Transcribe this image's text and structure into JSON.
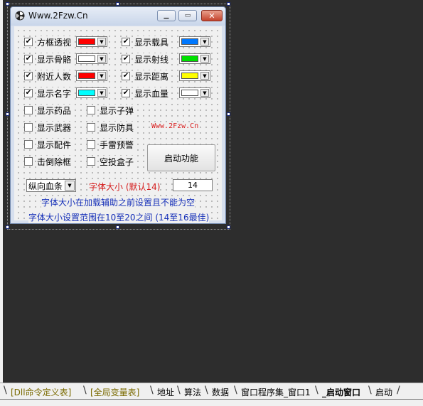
{
  "window": {
    "title": "Www.2Fzw.Cn"
  },
  "checkbox_grid": [
    {
      "label": "方框透视",
      "checked": true,
      "color": "#ff0000"
    },
    {
      "label": "显示骨骼",
      "checked": true,
      "color": "#ffffff"
    },
    {
      "label": "附近人数",
      "checked": true,
      "color": "#ff0000"
    },
    {
      "label": "显示名字",
      "checked": true,
      "color": "#00ffff"
    },
    {
      "label": "显示载具",
      "checked": true,
      "color": "#0078ff"
    },
    {
      "label": "显示射线",
      "checked": true,
      "color": "#00e000"
    },
    {
      "label": "显示距离",
      "checked": true,
      "color": "#ffff00"
    },
    {
      "label": "显示血量",
      "checked": true,
      "color": "#ffffff"
    }
  ],
  "plain_options": [
    {
      "label": "显示药品",
      "checked": false
    },
    {
      "label": "显示武器",
      "checked": false
    },
    {
      "label": "显示配件",
      "checked": false
    },
    {
      "label": "击倒除框",
      "checked": false
    },
    {
      "label": "显示子弹",
      "checked": false
    },
    {
      "label": "显示防具",
      "checked": false
    },
    {
      "label": "手雷预警",
      "checked": false
    },
    {
      "label": "空投盒子",
      "checked": false
    }
  ],
  "watermark": "Www.2Fzw.Cn",
  "start_button": "启动功能",
  "bloodbar_select": "纵向血条",
  "font_size_label": "字体大小 (默认14)",
  "font_size_value": "14",
  "notes": {
    "line1": "字体大小在加载辅助之前设置且不能为空",
    "line2": "字体大小设置范围在10至20之间 (14至16最佳)"
  },
  "tabs": [
    {
      "label": "[Dll命令定义表]",
      "style": "olive"
    },
    {
      "label": "[全局变量表]",
      "style": "olive"
    },
    {
      "label": "地址",
      "style": "normal"
    },
    {
      "label": "算法",
      "style": "normal"
    },
    {
      "label": "数据",
      "style": "normal"
    },
    {
      "label": "窗口程序集_窗口1",
      "style": "normal"
    },
    {
      "label": "_启动窗口",
      "style": "active"
    },
    {
      "label": "启动",
      "style": "normal"
    }
  ],
  "colors": {
    "accent_blue": "#1630b8",
    "warn_red": "#d41a1a",
    "workspace": "#2d2d2d"
  }
}
